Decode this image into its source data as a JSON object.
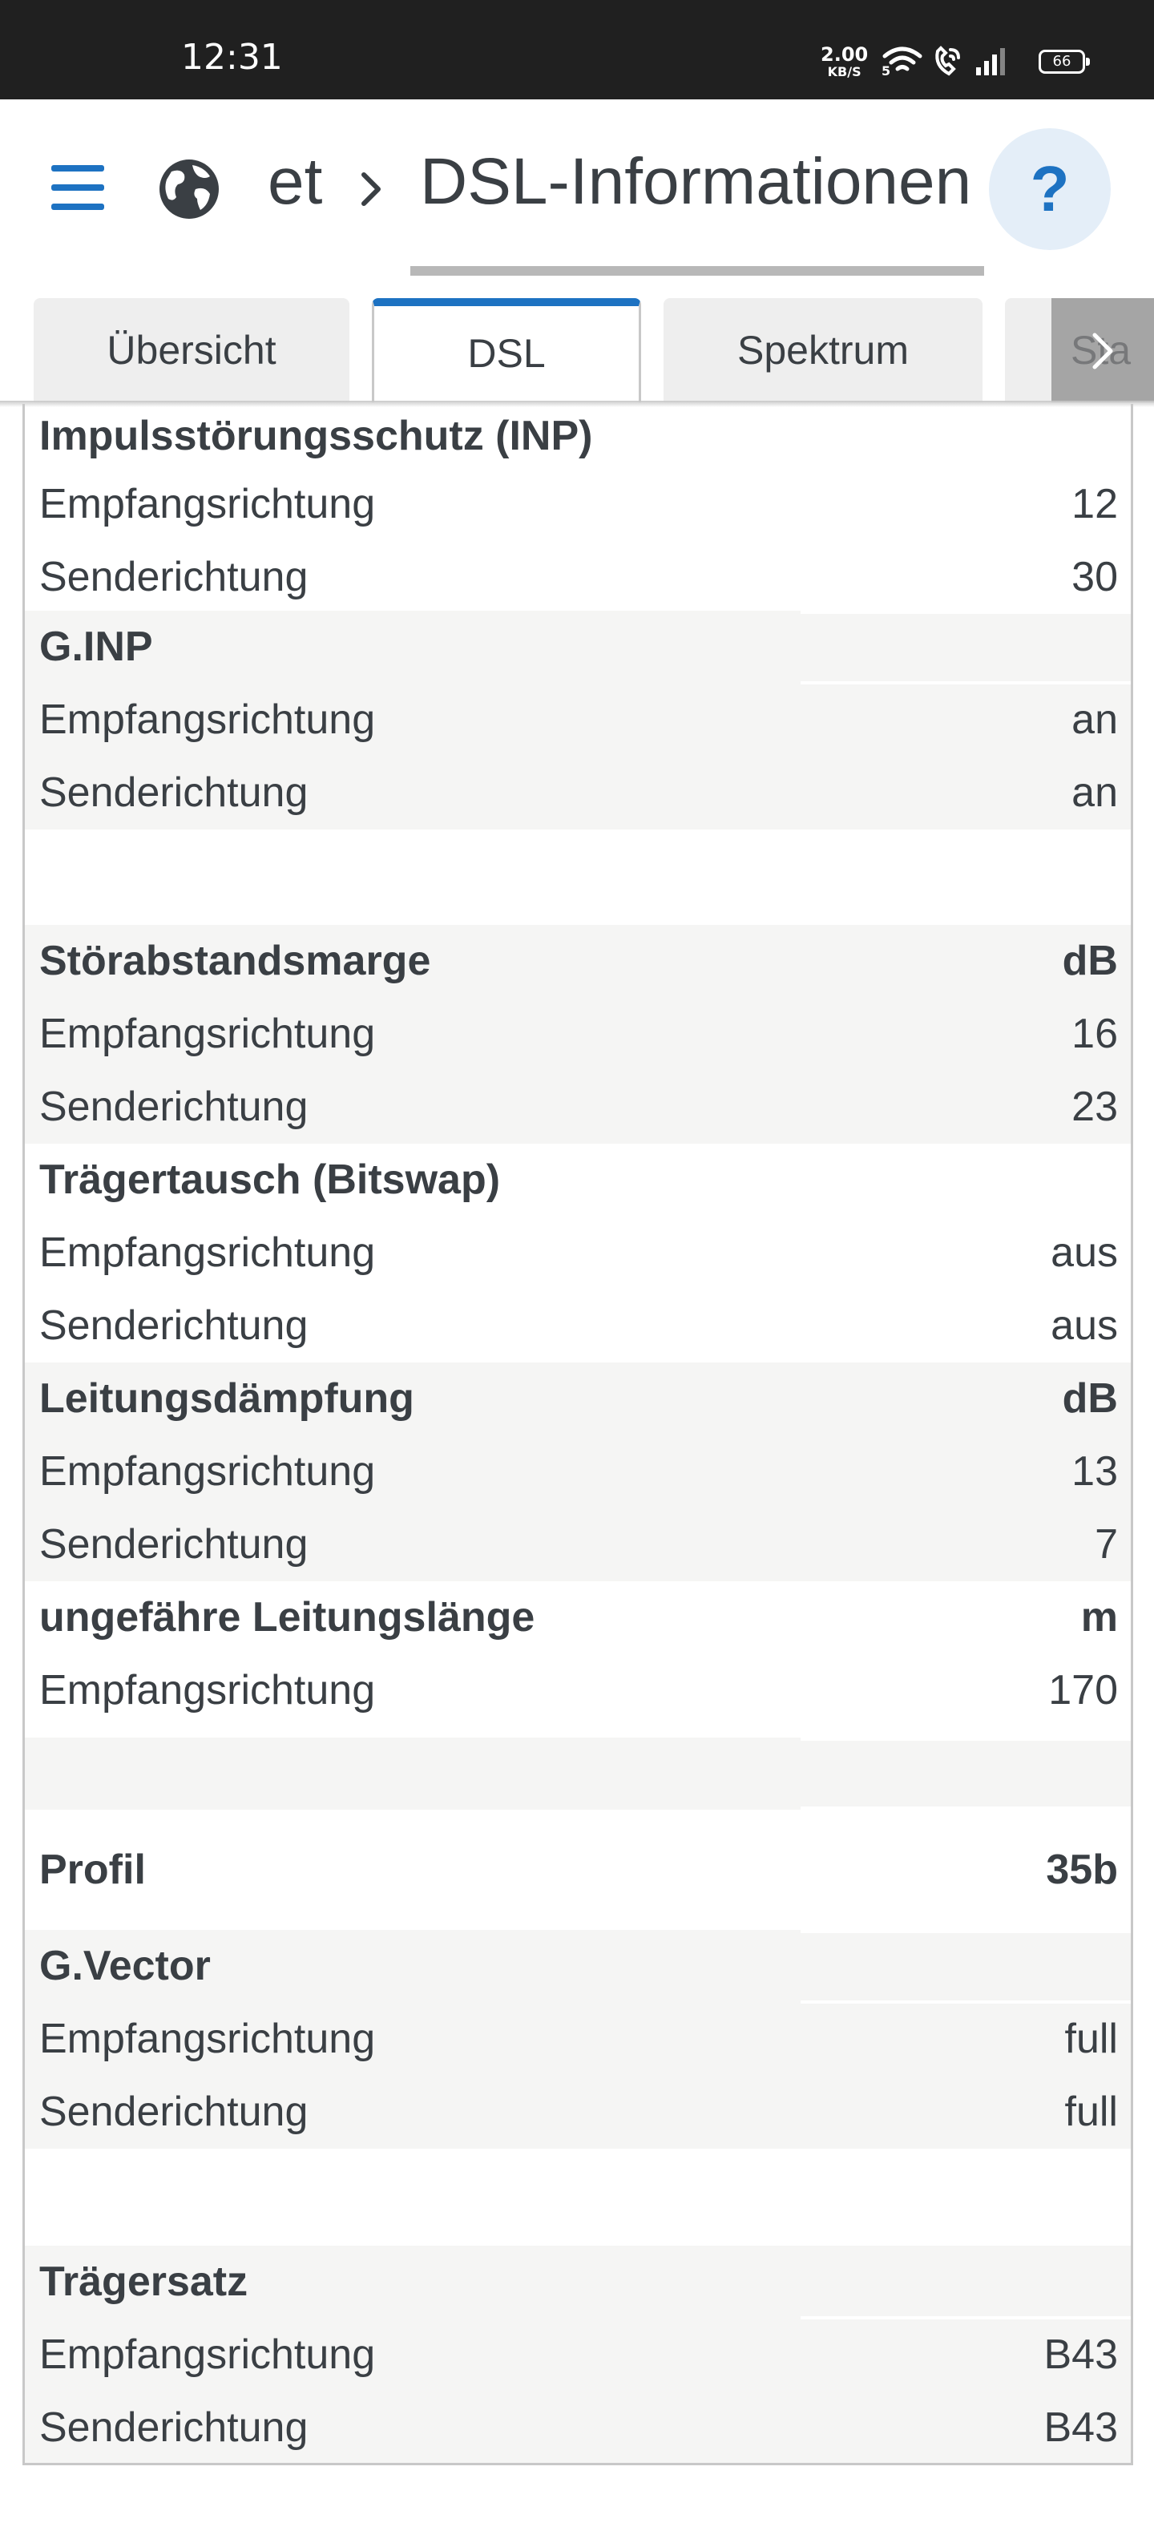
{
  "status_bar": {
    "time": "12:31",
    "net_speed_value": "2.00",
    "net_speed_unit": "KB/S",
    "battery": "66"
  },
  "header": {
    "breadcrumb_root": "et",
    "title": "DSL-Informationen",
    "help_label": "?"
  },
  "tabs": [
    {
      "label": "Übersicht",
      "active": false
    },
    {
      "label": "DSL",
      "active": true
    },
    {
      "label": "Spektrum",
      "active": false
    },
    {
      "label": "Sta",
      "active": false
    }
  ],
  "sections": {
    "inp": {
      "title": "Impulsstörungsschutz (INP)",
      "unit": "",
      "rx_label": "Empfangsrichtung",
      "rx": "12",
      "tx_label": "Senderichtung",
      "tx": "30"
    },
    "ginp": {
      "title": "G.INP",
      "unit": "",
      "rx_label": "Empfangsrichtung",
      "rx": "an",
      "tx_label": "Senderichtung",
      "tx": "an"
    },
    "snr": {
      "title": "Störabstandsmarge",
      "unit": "dB",
      "rx_label": "Empfangsrichtung",
      "rx": "16",
      "tx_label": "Senderichtung",
      "tx": "23"
    },
    "bitswap": {
      "title": "Trägertausch (Bitswap)",
      "unit": "",
      "rx_label": "Empfangsrichtung",
      "rx": "aus",
      "tx_label": "Senderichtung",
      "tx": "aus"
    },
    "attenuation": {
      "title": "Leitungsdämpfung",
      "unit": "dB",
      "rx_label": "Empfangsrichtung",
      "rx": "13",
      "tx_label": "Senderichtung",
      "tx": "7"
    },
    "length": {
      "title": "ungefähre Leitungslänge",
      "unit": "m",
      "rx_label": "Empfangsrichtung",
      "rx": "170"
    },
    "profile": {
      "title": "Profil",
      "value": "35b"
    },
    "gvector": {
      "title": "G.Vector",
      "unit": "",
      "rx_label": "Empfangsrichtung",
      "rx": "full",
      "tx_label": "Senderichtung",
      "tx": "full"
    },
    "carrier": {
      "title": "Trägersatz",
      "unit": "",
      "rx_label": "Empfangsrichtung",
      "rx": "B43",
      "tx_label": "Senderichtung",
      "tx": "B43"
    }
  },
  "colors": {
    "accent": "#1d72c2",
    "row_shade": "#f5f5f4",
    "status_bar": "#202020"
  }
}
